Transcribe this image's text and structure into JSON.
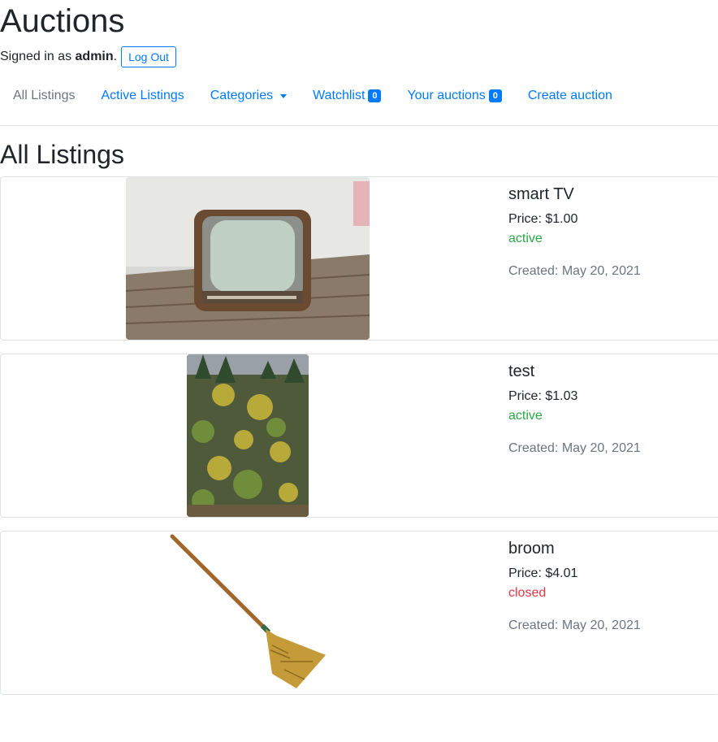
{
  "header": {
    "title": "Auctions",
    "signed_in_prefix": "Signed in as ",
    "username": "admin",
    "signed_in_suffix": ".",
    "logout_label": "Log Out"
  },
  "nav": {
    "all_listings": "All Listings",
    "active_listings": "Active Listings",
    "categories": "Categories",
    "watchlist": "Watchlist",
    "watchlist_count": "0",
    "your_auctions": "Your auctions",
    "your_auctions_count": "0",
    "create_auction": "Create auction"
  },
  "page": {
    "heading": "All Listings"
  },
  "colors": {
    "link": "#007bff",
    "muted": "#6c757d",
    "active": "#28a745",
    "closed": "#dc3545"
  },
  "listings": [
    {
      "title": "smart TV",
      "price": "Price: $1.00",
      "status": "active",
      "created": "Created: May 20, 2021"
    },
    {
      "title": "test",
      "price": "Price: $1.03",
      "status": "active",
      "created": "Created: May 20, 2021"
    },
    {
      "title": "broom",
      "price": "Price: $4.01",
      "status": "closed",
      "created": "Created: May 20, 2021"
    }
  ]
}
